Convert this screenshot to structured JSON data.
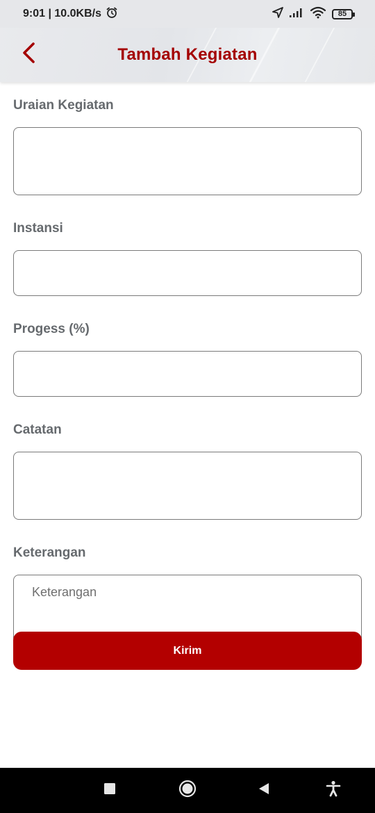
{
  "status_bar": {
    "time_speed": "9:01 | 10.0KB/s",
    "battery": "85",
    "icons": [
      "alarm-icon",
      "location-icon",
      "signal-icon",
      "wifi-icon",
      "battery-icon"
    ]
  },
  "header": {
    "title": "Tambah Kegiatan",
    "back_icon": "chevron-left-icon"
  },
  "form": {
    "uraian": {
      "label": "Uraian Kegiatan",
      "value": "",
      "placeholder": ""
    },
    "instansi": {
      "label": "Instansi",
      "value": "",
      "placeholder": ""
    },
    "progress": {
      "label": "Progess (%)",
      "value": "",
      "placeholder": ""
    },
    "catatan": {
      "label": "Catatan",
      "value": "",
      "placeholder": ""
    },
    "keterangan": {
      "label": "Keterangan",
      "value": "",
      "placeholder": "Keterangan"
    }
  },
  "submit": {
    "label": "Kirim"
  },
  "nav": {
    "items": [
      "recents-icon",
      "home-icon",
      "back-icon",
      "accessibility-icon"
    ]
  },
  "colors": {
    "accent": "#a40000",
    "button": "#b30000",
    "border": "#7a7a7a",
    "label": "#666a6e"
  }
}
